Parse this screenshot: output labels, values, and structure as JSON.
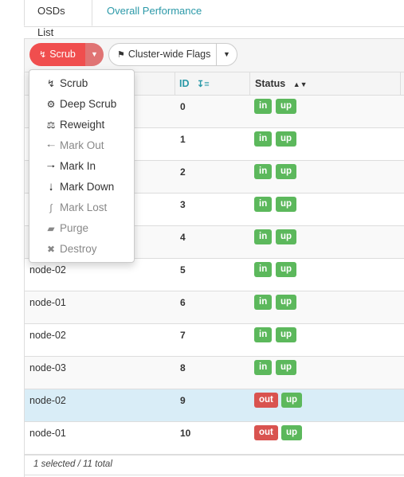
{
  "tabs": [
    {
      "label": "OSDs List",
      "active": true
    },
    {
      "label": "Overall Performance",
      "active": false
    }
  ],
  "toolbar": {
    "scrub_label": "Scrub",
    "flags_label": "Cluster-wide Flags",
    "accent": "#f04e4e"
  },
  "table": {
    "headers": {
      "id": "ID",
      "status": "Status"
    },
    "rows": [
      {
        "host": "",
        "id": "0",
        "status": [
          "in",
          "up"
        ]
      },
      {
        "host": "",
        "id": "1",
        "status": [
          "in",
          "up"
        ]
      },
      {
        "host": "",
        "id": "2",
        "status": [
          "in",
          "up"
        ]
      },
      {
        "host": "",
        "id": "3",
        "status": [
          "in",
          "up"
        ]
      },
      {
        "host": "",
        "id": "4",
        "status": [
          "in",
          "up"
        ]
      },
      {
        "host": "node-02",
        "id": "5",
        "status": [
          "in",
          "up"
        ]
      },
      {
        "host": "node-01",
        "id": "6",
        "status": [
          "in",
          "up"
        ]
      },
      {
        "host": "node-02",
        "id": "7",
        "status": [
          "in",
          "up"
        ]
      },
      {
        "host": "node-03",
        "id": "8",
        "status": [
          "in",
          "up"
        ]
      },
      {
        "host": "node-02",
        "id": "9",
        "status": [
          "out",
          "up"
        ],
        "selected": true
      },
      {
        "host": "node-01",
        "id": "10",
        "status": [
          "out",
          "up"
        ]
      }
    ]
  },
  "footer": {
    "summary": "1 selected / 11 total"
  },
  "menu": {
    "items": [
      {
        "label": "Scrub",
        "icon": "stethoscope-icon",
        "enabled": true
      },
      {
        "label": "Deep Scrub",
        "icon": "cog-icon",
        "enabled": true
      },
      {
        "label": "Reweight",
        "icon": "balance-scale-icon",
        "enabled": true
      },
      {
        "label": "Mark Out",
        "icon": "arrow-left-icon",
        "enabled": false
      },
      {
        "label": "Mark In",
        "icon": "arrow-right-icon",
        "enabled": true
      },
      {
        "label": "Mark Down",
        "icon": "arrow-down-icon",
        "enabled": true
      },
      {
        "label": "Mark Lost",
        "icon": "unlink-icon",
        "enabled": false
      },
      {
        "label": "Purge",
        "icon": "eraser-icon",
        "enabled": false
      },
      {
        "label": "Destroy",
        "icon": "times-icon",
        "enabled": false
      }
    ]
  },
  "colors": {
    "in": "#5cb85c",
    "up": "#5cb85c",
    "out": "#d9534f",
    "link": "#2b99a8",
    "selected_row": "#d9edf7"
  }
}
